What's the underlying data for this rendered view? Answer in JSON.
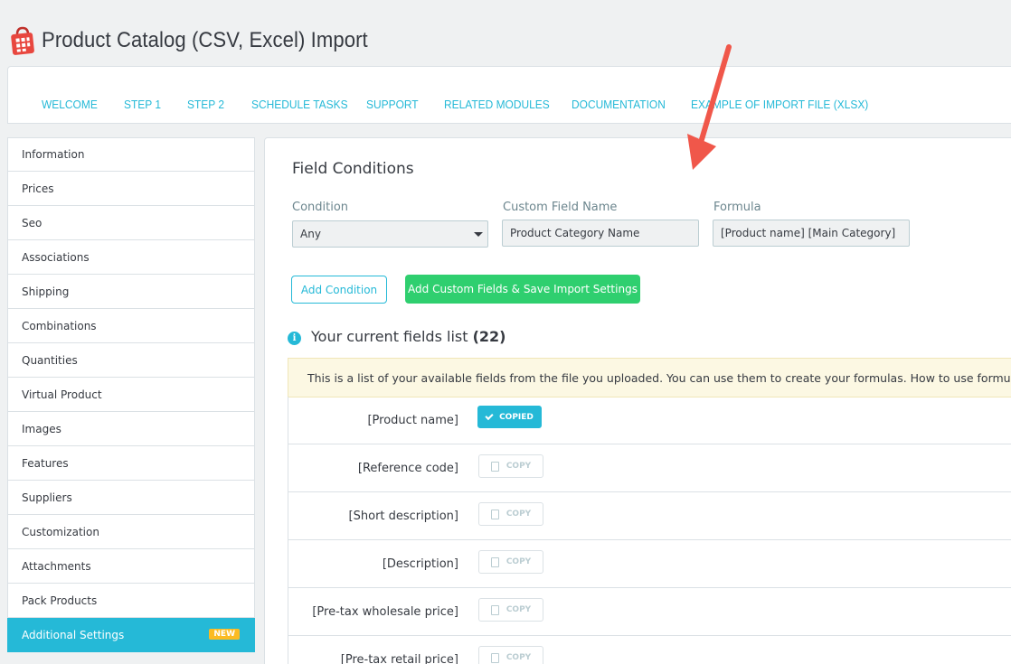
{
  "header": {
    "title": "Product Catalog (CSV, Excel) Import"
  },
  "tabs": [
    {
      "label": "WELCOME"
    },
    {
      "label": "STEP 1"
    },
    {
      "label": "STEP 2"
    },
    {
      "label": "SCHEDULE TASKS"
    },
    {
      "label": "SUPPORT"
    },
    {
      "label": "RELATED MODULES"
    },
    {
      "label": "DOCUMENTATION"
    },
    {
      "label": "EXAMPLE OF IMPORT FILE (XLSX)"
    }
  ],
  "active_tab": "STEP 2",
  "sidebar": {
    "items": [
      {
        "label": "Information"
      },
      {
        "label": "Prices"
      },
      {
        "label": "Seo"
      },
      {
        "label": "Associations"
      },
      {
        "label": "Shipping"
      },
      {
        "label": "Combinations"
      },
      {
        "label": "Quantities"
      },
      {
        "label": "Virtual Product"
      },
      {
        "label": "Images"
      },
      {
        "label": "Features"
      },
      {
        "label": "Suppliers"
      },
      {
        "label": "Customization"
      },
      {
        "label": "Attachments"
      },
      {
        "label": "Pack Products"
      },
      {
        "label": "Additional Settings",
        "badge": "NEW"
      }
    ]
  },
  "field_conditions": {
    "title": "Field Conditions",
    "condition_label": "Condition",
    "condition_value": "Any",
    "custom_field_label": "Custom Field Name",
    "custom_field_value": "Product Category Name",
    "formula_label": "Formula",
    "formula_value": "[Product name] [Main Category]",
    "add_condition_button": "Add Condition",
    "save_button": "Add Custom Fields & Save Import Settings"
  },
  "fields_list": {
    "heading": "Your current fields list",
    "count": "(22)",
    "notice": "This is a list of your available fields from the file you uploaded. You can use them to create your formulas. How to use formulas? C",
    "copied_label": "COPIED",
    "copy_label": "COPY",
    "rows": [
      {
        "name": "[Product name]",
        "state": "copied"
      },
      {
        "name": "[Reference code]",
        "state": "copy"
      },
      {
        "name": "[Short description]",
        "state": "copy"
      },
      {
        "name": "[Description]",
        "state": "copy"
      },
      {
        "name": "[Pre-tax wholesale price]",
        "state": "copy"
      },
      {
        "name": "[Pre-tax retail price]",
        "state": "copy"
      }
    ]
  },
  "colors": {
    "accent": "#25b9d7",
    "green": "#2fcf6f",
    "badge": "#fbbb22",
    "arrow": "#f0574a",
    "logo": "#e8473f"
  }
}
